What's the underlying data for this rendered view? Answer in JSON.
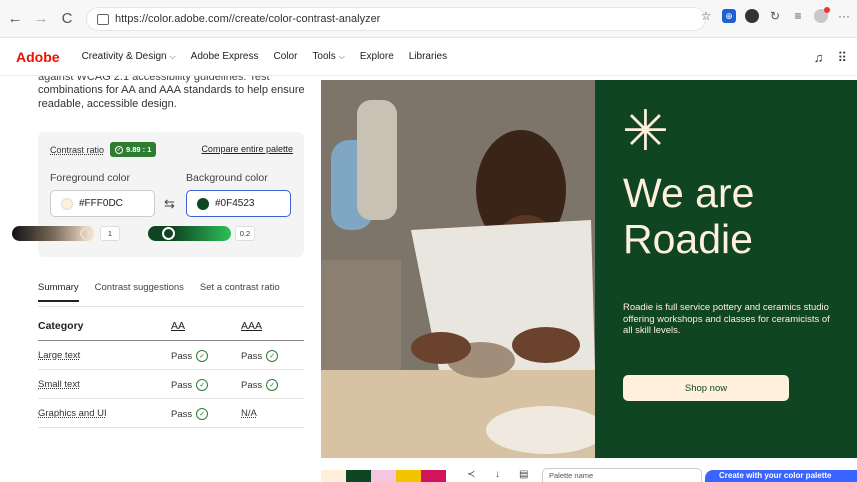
{
  "browser": {
    "url": "https://color.adobe.com//create/color-contrast-analyzer",
    "back": "←",
    "forward": "→",
    "reload": "C",
    "more": "···"
  },
  "nav": {
    "logo": "Adobe",
    "items": [
      "Creativity & Design",
      "Adobe Express",
      "Color",
      "Tools",
      "Explore",
      "Libraries"
    ],
    "bell_icon": "bell-icon",
    "apps_icon": "apps-grid-icon"
  },
  "intro": {
    "clipped_line": "against WCAG 2.1 accessibility guidelines. Test",
    "text": "combinations for AA and AAA standards to help ensure readable, accessible design."
  },
  "contrast": {
    "label": "Contrast ratio",
    "ratio": "9.89 : 1",
    "compare_link": "Compare entire palette",
    "fg_label": "Foreground color",
    "bg_label": "Background color",
    "fg_value": "#FFF0DC",
    "bg_value": "#0F4523",
    "fg_level": "1",
    "bg_level": "0.2"
  },
  "tabs": [
    "Summary",
    "Contrast suggestions",
    "Set a contrast ratio"
  ],
  "table": {
    "headers": [
      "Category",
      "AA",
      "AAA"
    ],
    "rows": [
      {
        "category": "Large text",
        "aa": "Pass",
        "aaa": "Pass"
      },
      {
        "category": "Small text",
        "aa": "Pass",
        "aaa": "Pass"
      },
      {
        "category": "Graphics and UI",
        "aa": "Pass",
        "aaa": "N/A"
      }
    ]
  },
  "preview": {
    "headline_line1": "We are",
    "headline_line2": "Roadie",
    "description": "Roadie is full service pottery and ceramics studio offering workshops and classes for ceramicists of all skill levels.",
    "button": "Shop now",
    "accent": "#0f4523",
    "cream": "#fff0dc"
  },
  "bottom": {
    "palette_name_label": "Palette name",
    "create_button": "Create with your color palette",
    "palette": [
      "#fff0dc",
      "#0f4523",
      "#f5c6e0",
      "#f2c400",
      "#d4145a"
    ]
  }
}
